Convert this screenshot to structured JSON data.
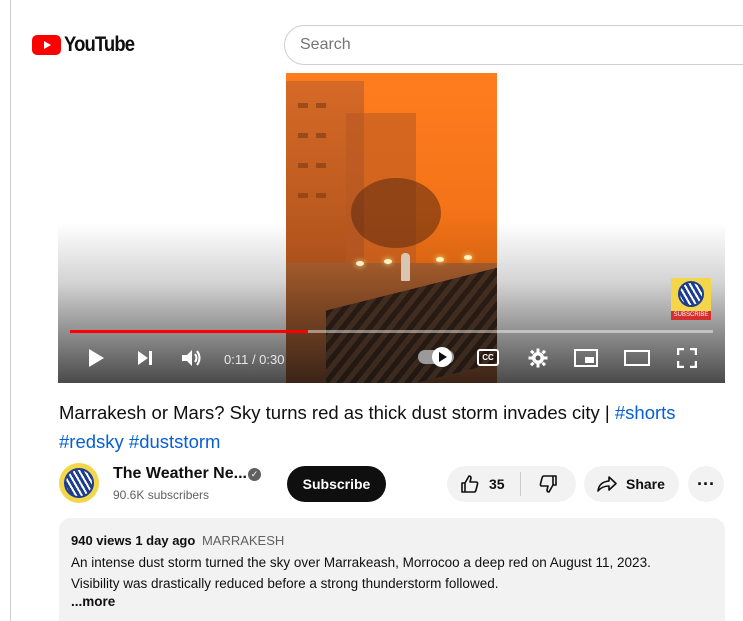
{
  "header": {
    "logo_text": "YouTube",
    "search_placeholder": "Search"
  },
  "player": {
    "time_display": "0:11 / 0:30",
    "progress_fraction": 0.37,
    "cc_label": "CC",
    "subscribe_watermark": "SUBSCRIBE"
  },
  "video": {
    "title": "Marrakesh or Mars? Sky turns red as thick dust storm invades city |",
    "hashtags": [
      "#shorts",
      "#redsky",
      "#duststorm"
    ]
  },
  "channel": {
    "name": "The Weather Ne...",
    "subscribers": "90.6K subscribers",
    "subscribe_label": "Subscribe"
  },
  "actions": {
    "like_count": "35",
    "share_label": "Share",
    "more_label": "···"
  },
  "description": {
    "views": "940 views",
    "age": "1 day ago",
    "location": "MARRAKESH",
    "line1": "An intense dust storm turned the sky over Marrakeash, Morrocoo a deep red on August 11, 2023.",
    "line2": "Visibility was drastically reduced before a strong thunderstorm followed.",
    "more_label": "...more"
  },
  "colors": {
    "brand_red": "#ff0000",
    "link_blue": "#065fd4",
    "sky_orange": "#ff7d1e"
  }
}
